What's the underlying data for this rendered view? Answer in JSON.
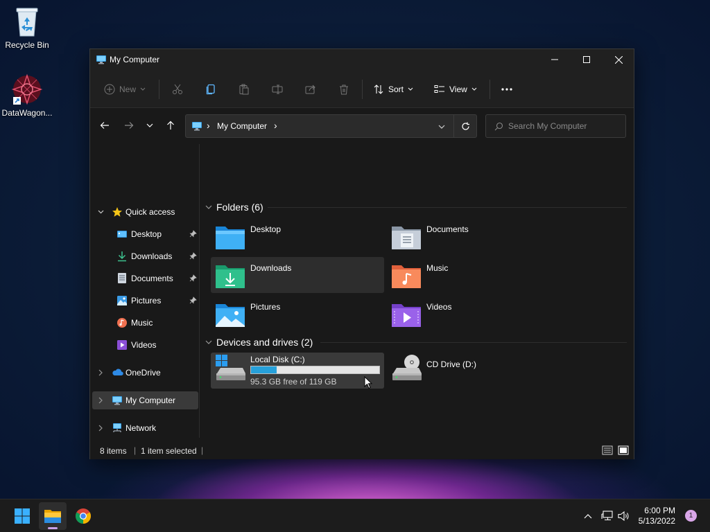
{
  "desktop": {
    "icons": [
      {
        "label": "Recycle Bin",
        "icon": "recycle-bin-icon"
      },
      {
        "label": "DataWagon...",
        "icon": "datawagon-app-icon"
      }
    ]
  },
  "window": {
    "title": "My Computer",
    "controls": {
      "minimize": "minimize-icon",
      "maximize": "maximize-icon",
      "close": "close-icon"
    }
  },
  "toolbar": {
    "new_label": "New",
    "sort_label": "Sort",
    "view_label": "View",
    "icons": [
      "new-icon",
      "cut-icon",
      "copy-icon",
      "paste-icon",
      "rename-icon",
      "share-icon",
      "delete-icon",
      "sort-icon",
      "view-icon",
      "more-icon"
    ]
  },
  "navigation": {
    "address_segment": "My Computer",
    "address_prefix": "›",
    "address_suffix": "›",
    "search_placeholder": "Search My Computer"
  },
  "sidebar": {
    "quick_access": "Quick access",
    "items": [
      {
        "label": "Desktop",
        "pinned": true
      },
      {
        "label": "Downloads",
        "pinned": true
      },
      {
        "label": "Documents",
        "pinned": true
      },
      {
        "label": "Pictures",
        "pinned": true
      },
      {
        "label": "Music",
        "pinned": false
      },
      {
        "label": "Videos",
        "pinned": false
      }
    ],
    "onedrive": "OneDrive",
    "my_computer": "My Computer",
    "network": "Network"
  },
  "content": {
    "folders_header": "Folders (6)",
    "folders": [
      {
        "name": "Desktop"
      },
      {
        "name": "Documents"
      },
      {
        "name": "Downloads"
      },
      {
        "name": "Music"
      },
      {
        "name": "Pictures"
      },
      {
        "name": "Videos"
      }
    ],
    "drives_header": "Devices and drives (2)",
    "drives": [
      {
        "name": "Local Disk (C:)",
        "free_text": "95.3 GB free of 119 GB",
        "used_fraction": 0.2
      },
      {
        "name": "CD Drive (D:)"
      }
    ]
  },
  "status": {
    "items": "8 items",
    "selected": "1 item selected"
  },
  "taskbar": {
    "time": "6:00 PM",
    "date": "5/13/2022",
    "notifications": "1"
  },
  "colors": {
    "accent": "#26a0da",
    "window_bg": "#191919",
    "selected_bg": "#3a3a3a"
  }
}
